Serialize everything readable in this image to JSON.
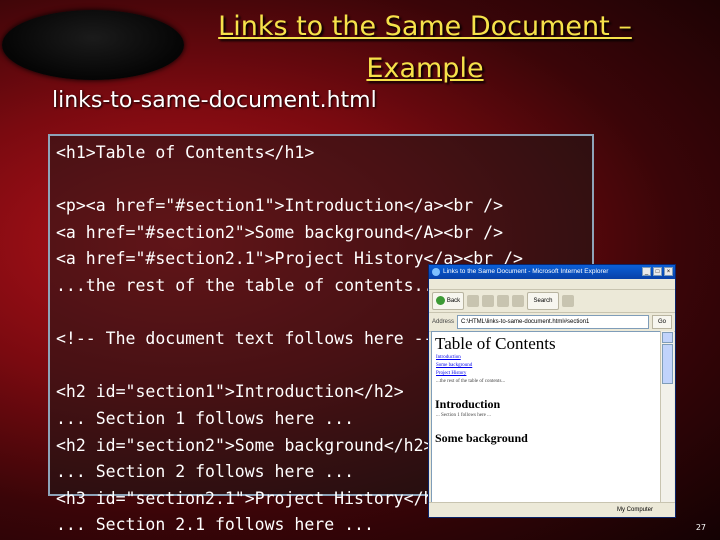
{
  "slide": {
    "title_line1": "Links to the Same Document –",
    "title_line2": "Example",
    "subtitle": "links-to-same-document.html",
    "code_lines": [
      "<h1>Table of Contents</h1>",
      "",
      "<p><a href=\"#section1\">Introduction</a><br />",
      "<a href=\"#section2\">Some background</A><br />",
      "<a href=\"#section2.1\">Project History</a><br />",
      "...the rest of the table of contents...",
      "",
      "<!-- The document text follows here -->",
      "",
      "<h2 id=\"section1\">Introduction</h2>",
      "... Section 1 follows here ...",
      "<h2 id=\"section2\">Some background</h2>",
      "... Section 2 follows here ...",
      "<h3 id=\"section2.1\">Project History</h3>",
      "... Section 2.1 follows here ..."
    ],
    "page_number": "27"
  },
  "browser": {
    "window_title": "Links to the Same Document - Microsoft Internet Explorer",
    "back_label": "Back",
    "search_label": "Search",
    "address_label": "Address",
    "address_value": "C:\\HTML\\links-to-same-document.html#section1",
    "go_label": "Go",
    "content": {
      "heading": "Table of Contents",
      "links": [
        "Introduction",
        "Some background",
        "Project History"
      ],
      "toc_rest": "...the rest of the table of contents...",
      "section1_heading": "Introduction",
      "section1_text": "... Section 1 follows here ...",
      "section2_heading": "Some background"
    },
    "status_zone": "My Computer"
  },
  "colors": {
    "title": "#f6e24a",
    "text": "#ffffff",
    "box_border": "#8ea3b8",
    "link": "#0000ee"
  }
}
